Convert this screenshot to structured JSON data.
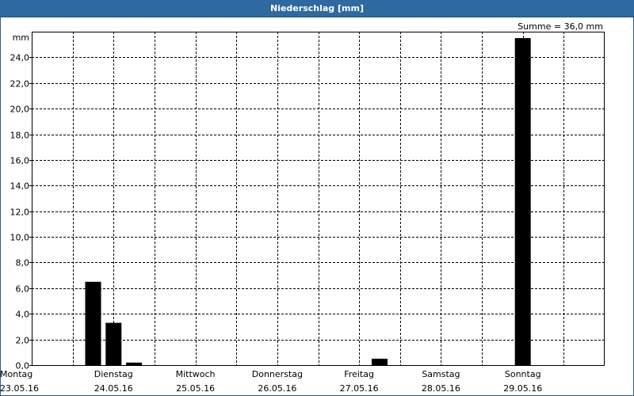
{
  "window": {
    "title": "Niederschlag [mm]"
  },
  "summary": {
    "sum_label": "Summe = 36,0 mm"
  },
  "colors": {
    "title_bar": "#2e6aa0",
    "bar_fill": "#000000",
    "grid": "#000000"
  },
  "chart_data": {
    "type": "bar",
    "title": "Niederschlag [mm]",
    "ylabel": "mm",
    "xlabel": "",
    "ylim": [
      0,
      26
    ],
    "ytick_step": 2,
    "decimal_separator": ",",
    "grid": true,
    "day_ticks": [
      {
        "day": "Montag",
        "date": "23.05.16"
      },
      {
        "day": "Dienstag",
        "date": "24.05.16"
      },
      {
        "day": "Mittwoch",
        "date": "25.05.16"
      },
      {
        "day": "Donnerstag",
        "date": "26.05.16"
      },
      {
        "day": "Freitag",
        "date": "27.05.16"
      },
      {
        "day": "Samstag",
        "date": "28.05.16"
      },
      {
        "day": "Sonntag",
        "date": "29.05.16"
      }
    ],
    "bars": [
      {
        "date": "23.05.16",
        "time": "18:00",
        "value": 6.5
      },
      {
        "date": "24.05.16",
        "time": "00:00",
        "value": 3.3
      },
      {
        "date": "24.05.16",
        "time": "06:00",
        "value": 0.2
      },
      {
        "date": "27.05.16",
        "time": "06:00",
        "value": 0.5
      },
      {
        "date": "29.05.16",
        "time": "00:00",
        "value": 25.5
      }
    ]
  }
}
